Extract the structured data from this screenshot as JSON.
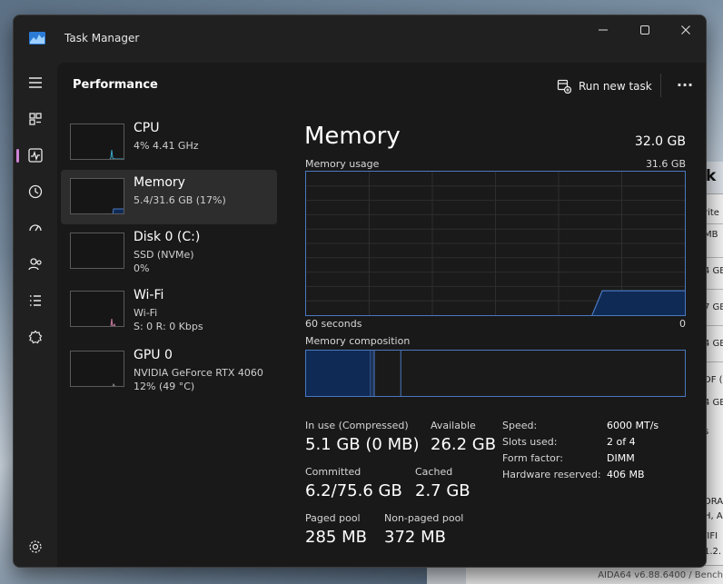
{
  "window": {
    "title": "Task Manager",
    "page_title": "Performance",
    "run_new_task": "Run new task"
  },
  "background": {
    "header_char": "k",
    "rows": [
      "rite",
      "MB",
      "4 GB",
      "7 GB",
      "4 GB",
      "DF (",
      "4 GB",
      "s"
    ],
    "lower_rows": [
      "DRA",
      "H, A",
      "/IFI",
      "1.2."
    ],
    "status": "AIDA64 v6.88.6400 / Bench"
  },
  "nav": [
    "hamburger-icon",
    "processes-icon",
    "performance-icon",
    "app-history-icon",
    "startup-apps-icon",
    "users-icon",
    "details-icon",
    "services-icon",
    "settings-icon"
  ],
  "devices": [
    {
      "name": "CPU",
      "line1": "4%  4.41 GHz",
      "line2": ""
    },
    {
      "name": "Memory",
      "line1": "5.4/31.6 GB (17%)",
      "line2": ""
    },
    {
      "name": "Disk 0 (C:)",
      "line1": "SSD (NVMe)",
      "line2": "0%"
    },
    {
      "name": "Wi-Fi",
      "line1": "Wi-Fi",
      "line2": "S: 0 R: 0 Kbps"
    },
    {
      "name": "GPU 0",
      "line1": "NVIDIA GeForce RTX 4060",
      "line2": "12%  (49 °C)"
    }
  ],
  "memory": {
    "title": "Memory",
    "total": "32.0 GB",
    "usage_label": "Memory usage",
    "usage_max": "31.6 GB",
    "axis_left": "60 seconds",
    "axis_right": "0",
    "composition_label": "Memory composition",
    "stats": {
      "in_use_label": "In use (Compressed)",
      "in_use": "5.1 GB (0 MB)",
      "available_label": "Available",
      "available": "26.2 GB",
      "committed_label": "Committed",
      "committed": "6.2/75.6 GB",
      "cached_label": "Cached",
      "cached": "2.7 GB",
      "paged_label": "Paged pool",
      "paged": "285 MB",
      "nonpaged_label": "Non-paged pool",
      "nonpaged": "372 MB"
    },
    "details": [
      {
        "label": "Speed:",
        "value": "6000 MT/s"
      },
      {
        "label": "Slots used:",
        "value": "2 of 4"
      },
      {
        "label": "Form factor:",
        "value": "DIMM"
      },
      {
        "label": "Hardware reserved:",
        "value": "406 MB"
      }
    ],
    "composition_fraction": {
      "in_use": 0.17,
      "modified": 0.01,
      "standby": 0.07
    },
    "usage_fraction": 0.17
  },
  "colors": {
    "memory_line": "#4a78c0",
    "memory_fill": "#0f2a54",
    "cpu_line": "#3aa6c8",
    "wifi_line": "#c77aa0",
    "accent": "#cf84d6"
  }
}
